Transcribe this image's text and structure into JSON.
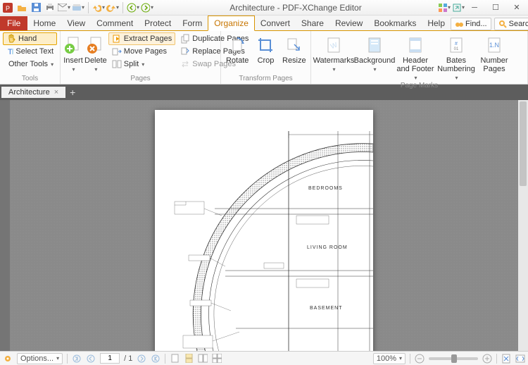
{
  "title": "Architecture - PDF-XChange Editor",
  "qat": {
    "items": [
      "app",
      "open",
      "save",
      "print",
      "email",
      "scan",
      "undo",
      "redo",
      "back",
      "forward"
    ]
  },
  "tabs": {
    "file": "File",
    "items": [
      "Home",
      "View",
      "Comment",
      "Protect",
      "Form",
      "Organize",
      "Convert",
      "Share",
      "Review",
      "Bookmarks",
      "Help"
    ],
    "active": "Organize",
    "find": "Find...",
    "search": "Search..."
  },
  "ribbon": {
    "tools": {
      "label": "Tools",
      "hand": "Hand",
      "select": "Select Text",
      "other": "Other Tools"
    },
    "pages": {
      "label": "Pages",
      "insert": "Insert",
      "delete": "Delete",
      "extract": "Extract Pages",
      "move": "Move Pages",
      "split": "Split",
      "duplicate": "Duplicate Pages",
      "replace": "Replace Pages",
      "swap": "Swap Pages"
    },
    "transform": {
      "label": "Transform Pages",
      "rotate": "Rotate",
      "crop": "Crop",
      "resize": "Resize"
    },
    "marks": {
      "label": "Page Marks",
      "watermarks": "Watermarks",
      "background": "Background",
      "headerfooter": "Header and Footer",
      "bates": "Bates Numbering",
      "number": "Number Pages"
    }
  },
  "doctab": {
    "name": "Architecture",
    "close": "×"
  },
  "drawing": {
    "rooms": {
      "bedrooms": "BEDROOMS",
      "living": "LIVING ROOM",
      "basement": "BASEMENT"
    }
  },
  "status": {
    "options": "Options...",
    "page_current": "1",
    "page_total": "/ 1",
    "zoom": "100%"
  }
}
